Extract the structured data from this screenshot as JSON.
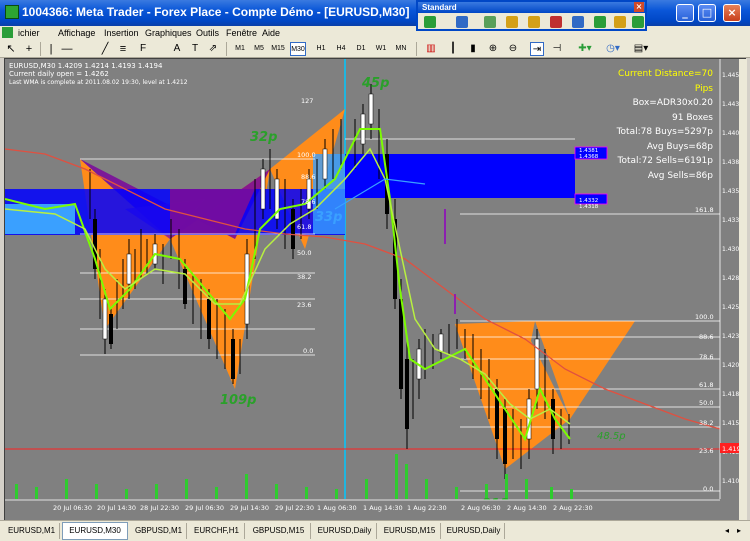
{
  "window": {
    "title": "1004366: Meta Trader - Forex Place - Compte Démo - [EURUSD,M30]",
    "min_label": "_",
    "max_label": "□",
    "close_label": "×"
  },
  "menu": [
    "ichier",
    "Affichage",
    "Insertion",
    "Graphiques",
    "Outils",
    "Fenêtre",
    "Aide"
  ],
  "standard_toolbar": {
    "title": "Standard",
    "close_label": "×"
  },
  "timeframes": {
    "items": [
      "M1",
      "M5",
      "M15",
      "M30",
      "H1",
      "H4",
      "D1",
      "W1",
      "MN"
    ],
    "active": "M30"
  },
  "chart": {
    "symbol_line": "EURUSD,M30  1.4209 1.4214 1.4193 1.4194",
    "daily_open": "Current daily open = 1.4262",
    "last_high": "Last WMA is complete at 2011.08.02 19:30, level at 1.4212",
    "labels": {
      "p45": "45p",
      "p32": "32p",
      "p109": "109p",
      "p33": "33p",
      "p213": "213p",
      "p48": "48.5p"
    },
    "fib_left": [
      "127",
      "100.0",
      "88.6",
      "78.6",
      "61.8",
      "50.0",
      "38.2",
      "23.6",
      "0.0"
    ],
    "fib_right": [
      "161.8",
      "100.0",
      "88.6",
      "78.6",
      "61.8",
      "50.0",
      "38.2",
      "23.6",
      "0.0"
    ],
    "price_axis": [
      "1.4454",
      "1.4430",
      "1.4405",
      "1.4380",
      "1.4355",
      "1.4330",
      "1.4305",
      "1.4280",
      "1.4255",
      "1.4230",
      "1.4205",
      "1.4180",
      "1.4155",
      "1.4130",
      "1.4105"
    ],
    "current_price": "1.4194",
    "zone_prices": [
      "1.4381",
      "1.4368",
      "1.4332",
      "1.4318"
    ],
    "time_axis": [
      "20 Jul 06:30",
      "20 Jul 14:30",
      "28 Jul 22:30",
      "29 Jul 06:30",
      "29 Jul 14:30",
      "29 Jul 22:30",
      "1 Aug 06:30",
      "1 Aug 14:30",
      "1 Aug 22:30",
      "2 Aug 06:30",
      "2 Aug 14:30",
      "2 Aug 22:30"
    ]
  },
  "info": {
    "line1": "Current Distance=70 Pips",
    "line2": "Box=ADR30x0.20",
    "line3": "91 Boxes",
    "line4": "Total:78 Buys=5297p",
    "line5": "Avg Buys=68p",
    "line6": "Total:72 Sells=6191p",
    "line7": "Avg Sells=86p"
  },
  "tabs": [
    "EURUSD,M1",
    "EURUSD,M30",
    "GBPUSD,M1",
    "EURCHF,H1",
    "GBPUSD,M15",
    "EURUSD,Daily",
    "EURUSD,M15",
    "EURUSD,Daily"
  ],
  "active_tab": "EURUSD,M30",
  "colors": {
    "chart_bg": "#808080",
    "orange": "#ff8c1a",
    "purple": "#7a0c9a",
    "blue": "#0000ff",
    "green": "#7cfc00",
    "red": "#cc3333"
  }
}
